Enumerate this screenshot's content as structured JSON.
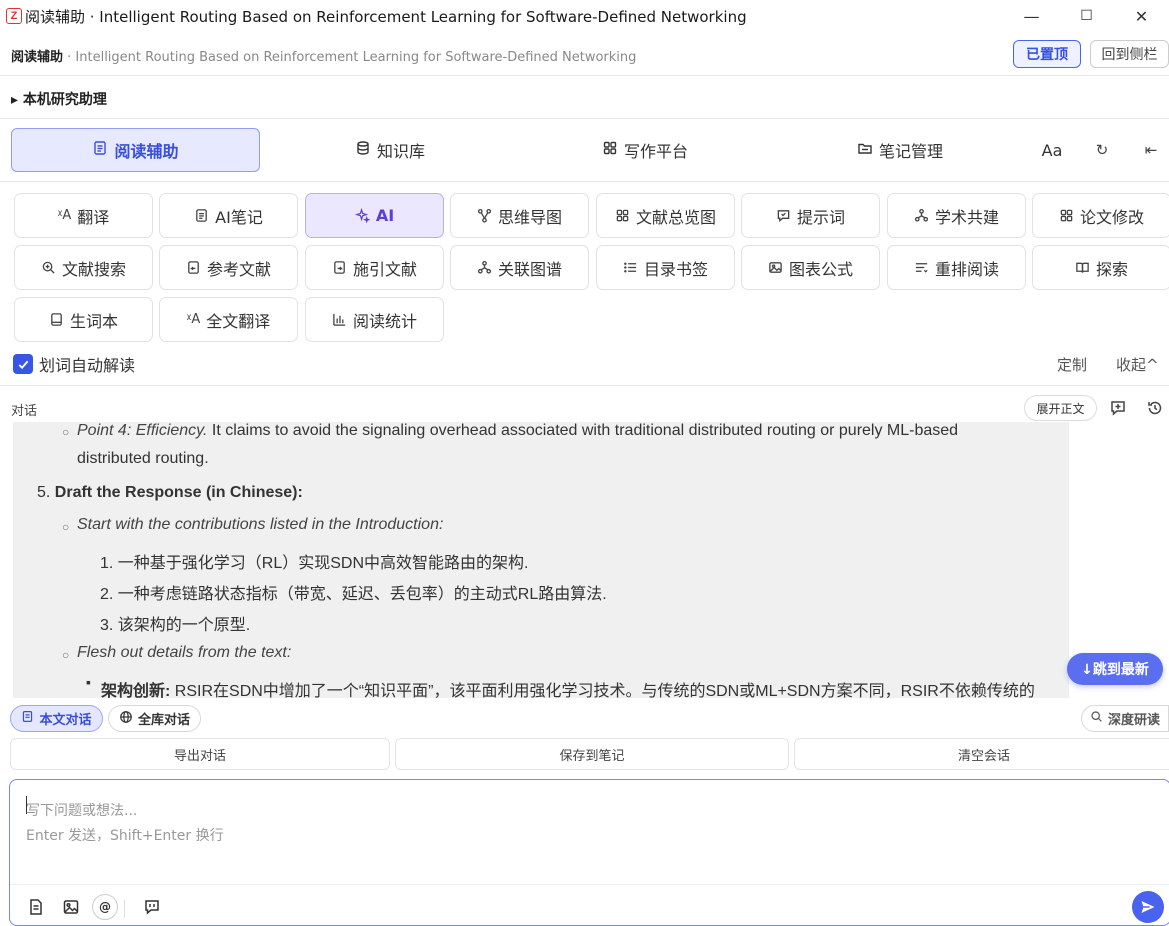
{
  "window": {
    "logo": "Z",
    "title": "阅读辅助 · Intelligent Routing Based on Reinforcement Learning for Software-Defined Networking",
    "minimize": "—",
    "maximize": "☐",
    "close": "✕"
  },
  "header": {
    "title_bold": "阅读辅助",
    "title_rest": " · Intelligent Routing Based on Reinforcement Learning for Software-Defined Networking",
    "pinned_label": "已置顶",
    "back_to_sidebar_label": "回到侧栏"
  },
  "assistant_section": {
    "label": "▸ 本机研究助理"
  },
  "tabs": [
    {
      "label": "阅读辅助",
      "icon": "document-icon",
      "active": true
    },
    {
      "label": "知识库",
      "icon": "database-icon",
      "active": false
    },
    {
      "label": "写作平台",
      "icon": "grid-icon",
      "active": false
    },
    {
      "label": "笔记管理",
      "icon": "folder-icon",
      "active": false
    }
  ],
  "tab_tools": {
    "font_size": "Aa",
    "refresh": "↻",
    "collapse": "⇤"
  },
  "tools": [
    {
      "label": "翻译",
      "icon": "translate-icon"
    },
    {
      "label": "AI笔记",
      "icon": "note-icon"
    },
    {
      "label": "AI",
      "icon": "sparkle-icon",
      "active": true
    },
    {
      "label": "思维导图",
      "icon": "mindmap-icon"
    },
    {
      "label": "文献总览图",
      "icon": "grid-icon"
    },
    {
      "label": "提示词",
      "icon": "prompt-icon"
    },
    {
      "label": "学术共建",
      "icon": "network-icon"
    },
    {
      "label": "论文修改",
      "icon": "grid-icon"
    },
    {
      "label": "文献搜索",
      "icon": "search-icon"
    },
    {
      "label": "参考文献",
      "icon": "reference-icon"
    },
    {
      "label": "施引文献",
      "icon": "citing-icon"
    },
    {
      "label": "关联图谱",
      "icon": "network-icon"
    },
    {
      "label": "目录书签",
      "icon": "list-icon"
    },
    {
      "label": "图表公式",
      "icon": "image-icon"
    },
    {
      "label": "重排阅读",
      "icon": "reflow-icon"
    },
    {
      "label": "探索",
      "icon": "book-icon"
    },
    {
      "label": "生词本",
      "icon": "notebook-icon"
    },
    {
      "label": "全文翻译",
      "icon": "translate-icon"
    },
    {
      "label": "阅读统计",
      "icon": "bar-chart-icon"
    }
  ],
  "auto_explain": {
    "label": "划词自动解读",
    "checked": true,
    "customize": "定制",
    "collapse": "收起^"
  },
  "chat": {
    "label": "对话",
    "expand_label": "展开正文",
    "jump_latest": "↓跳到最新",
    "content": {
      "point4_label": "Point 4: Efficiency.",
      "point4_text": " It claims to avoid the signaling overhead associated with traditional distributed routing or purely ML-based",
      "point4_cont": "distributed routing.",
      "step5_num": "5.",
      "step5_title": "Draft the Response (in Chinese):",
      "contrib_intro": "Start with the contributions listed in the Introduction:",
      "contrib_items": [
        "1. 一种基于强化学习（RL）实现SDN中高效智能路由的架构.",
        "2. 一种考虑链路状态指标（带宽、延迟、丢包率）的主动式RL路由算法.",
        "3. 该架构的一个原型."
      ],
      "flesh_intro": "Flesh out details from the text:",
      "arch_label": "架构创新:",
      "arch_text": " RSIR在SDN中增加了一个“知识平面”，该平面利用强化学习技术。与传统的SDN或ML+SDN方案不同，RSIR不依赖传统的"
    }
  },
  "modes": [
    {
      "label": "本文对话",
      "icon": "document-icon",
      "active": true
    },
    {
      "label": "全库对话",
      "icon": "globe-icon",
      "active": false
    }
  ],
  "deep_research": "深度研读",
  "actions": {
    "export": "导出对话",
    "save_note": "保存到笔记",
    "clear": "清空会话"
  },
  "input": {
    "placeholder_line1": "写下问题或想法...",
    "placeholder_line2": "Enter 发送，Shift+Enter 换行",
    "at_symbol": "@"
  }
}
